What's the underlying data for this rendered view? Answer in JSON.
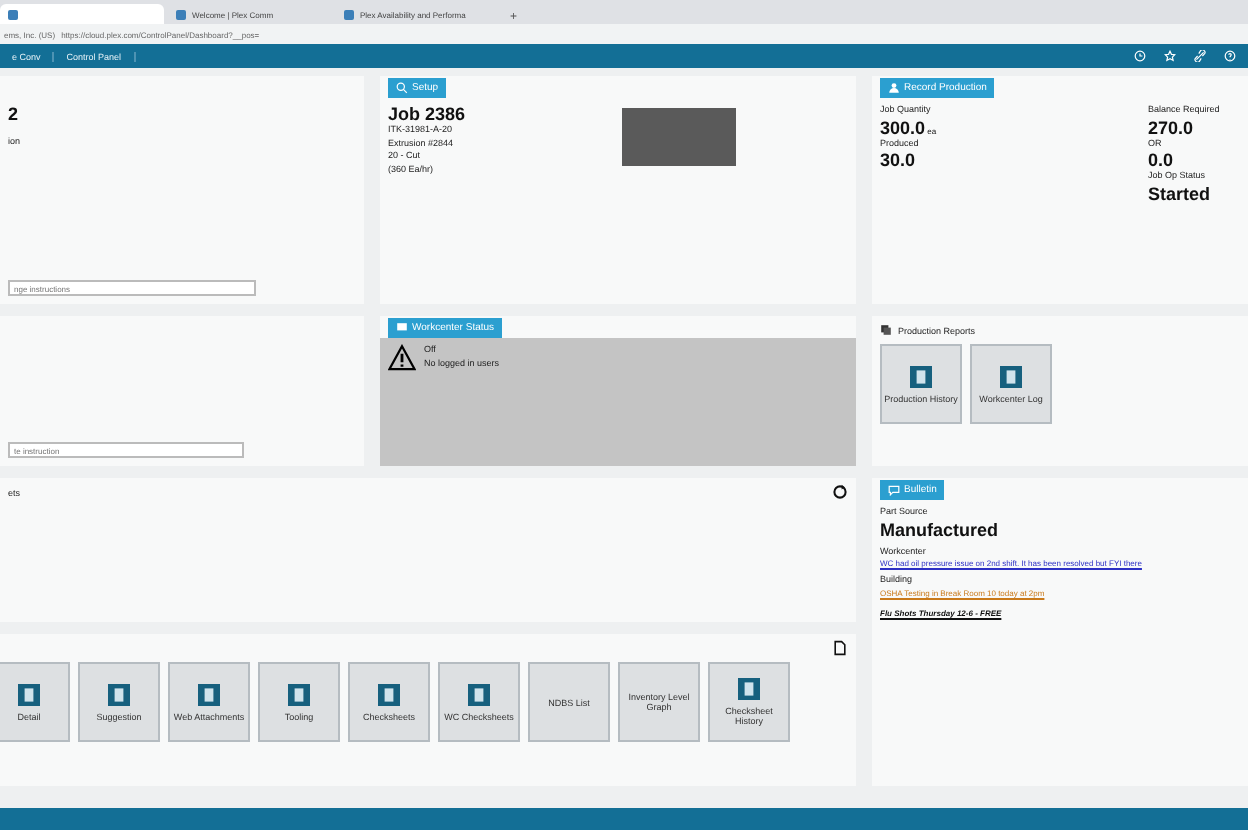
{
  "browser": {
    "tabs": [
      {
        "selected": true
      },
      {
        "label": "Welcome | Plex Comm",
        "selected": false
      },
      {
        "label": "Plex Availability and Performa",
        "selected": false
      }
    ],
    "new_tab": "+",
    "site": "ems, Inc. (US)",
    "url": "https://cloud.plex.com/ControlPanel/Dashboard?__pos="
  },
  "nav": {
    "items": [
      "e Conv",
      "Control Panel"
    ]
  },
  "left_panel": {
    "title": "2",
    "line": "ion",
    "field_placeholder": "nge instructions"
  },
  "setup": {
    "button": "Setup",
    "job": "Job 2386",
    "lines": [
      "ITK-31981-A-20",
      "Extrusion #2844",
      "20 - Cut",
      "(360 Ea/hr)"
    ]
  },
  "record": {
    "button": "Record Production",
    "stats": [
      {
        "label": "Job Quantity",
        "value": "300.0",
        "unit": "ea"
      },
      {
        "label": "Balance Required",
        "value": "270.0"
      },
      {
        "label": "Produced",
        "value": "30.0"
      },
      {
        "label": "OR",
        "value": "0.0"
      }
    ],
    "status_label": "Job Op Status",
    "status": "Started"
  },
  "left_panel_2": {
    "field_placeholder": "te instruction"
  },
  "workcenter_status": {
    "button": "Workcenter Status",
    "state": "Off",
    "users": "No logged in users"
  },
  "production_reports": {
    "title": "Production Reports",
    "tiles": [
      "Production History",
      "Workcenter Log"
    ]
  },
  "sheets_panel": {
    "title": "ets"
  },
  "bulletin": {
    "button": "Bulletin",
    "part_source_label": "Part Source",
    "part_source": "Manufactured",
    "workcenter_label": "Workcenter",
    "workcenter_note": "WC had oil pressure issue on 2nd shift. It has been resolved but FYI there",
    "building_label": "Building",
    "building_note": "OSHA Testing in Break Room 10 today at 2pm",
    "extra": "Flu Shots Thursday 12-6 - FREE"
  },
  "tiles": [
    {
      "kind": "icon",
      "label": "Detail"
    },
    {
      "kind": "icon",
      "label": "Suggestion"
    },
    {
      "kind": "icon",
      "label": "Web Attachments"
    },
    {
      "kind": "icon",
      "label": "Tooling"
    },
    {
      "kind": "icon",
      "label": "Checksheets"
    },
    {
      "kind": "icon",
      "label": "WC Checksheets"
    },
    {
      "kind": "text",
      "label": "NDBS List"
    },
    {
      "kind": "text",
      "label": "Inventory Level Graph"
    },
    {
      "kind": "icon",
      "label": "Checksheet History"
    }
  ]
}
